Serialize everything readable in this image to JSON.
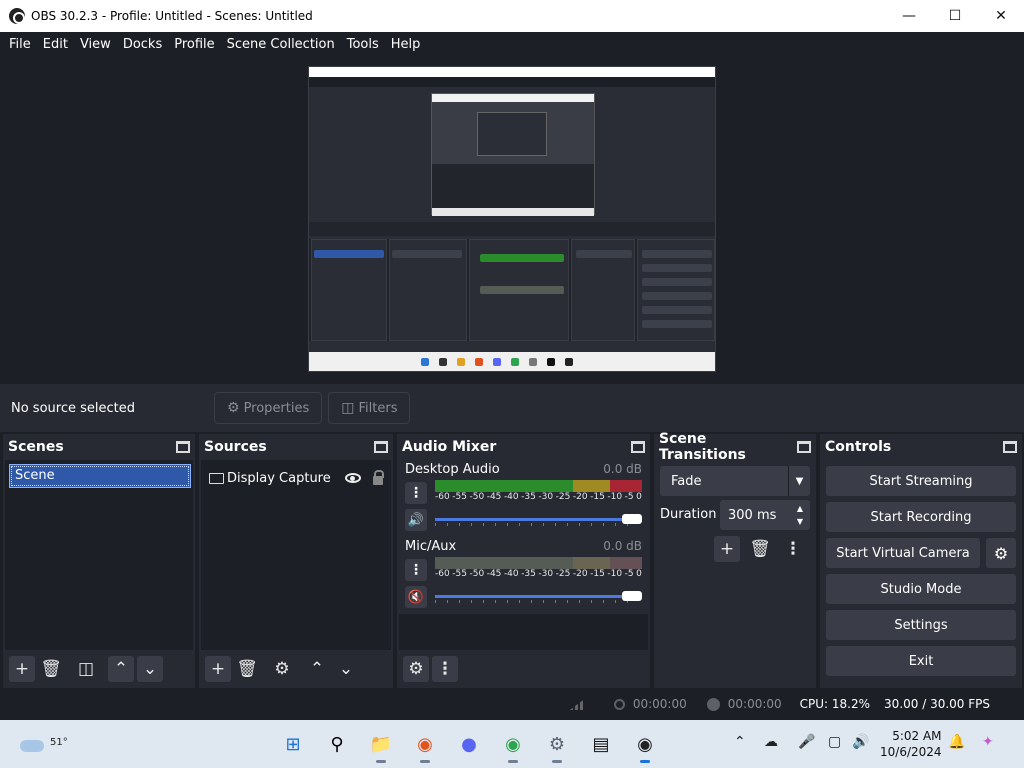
{
  "window": {
    "title": "OBS 30.2.3 - Profile: Untitled - Scenes: Untitled"
  },
  "menu": [
    "File",
    "Edit",
    "View",
    "Docks",
    "Profile",
    "Scene Collection",
    "Tools",
    "Help"
  ],
  "source_bar": {
    "no_source": "No source selected",
    "properties": "Properties",
    "filters": "Filters"
  },
  "docks": {
    "scenes": {
      "title": "Scenes",
      "items": [
        "Scene"
      ]
    },
    "sources": {
      "title": "Sources",
      "items": [
        "Display Capture"
      ]
    },
    "mixer": {
      "title": "Audio Mixer",
      "channels": [
        {
          "name": "Desktop Audio",
          "db": "0.0 dB",
          "muted": false
        },
        {
          "name": "Mic/Aux",
          "db": "0.0 dB",
          "muted": true
        }
      ],
      "ticks": [
        "-60",
        "-55",
        "-50",
        "-45",
        "-40",
        "-35",
        "-30",
        "-25",
        "-20",
        "-15",
        "-10",
        "-5",
        "0"
      ]
    },
    "transitions": {
      "title": "Scene Transitions",
      "selected": "Fade",
      "duration_label": "Duration",
      "duration": "300 ms"
    },
    "controls": {
      "title": "Controls",
      "start_streaming": "Start Streaming",
      "start_recording": "Start Recording",
      "start_virtual_camera": "Start Virtual Camera",
      "studio_mode": "Studio Mode",
      "settings": "Settings",
      "exit": "Exit"
    }
  },
  "status": {
    "stream_time": "00:00:00",
    "record_time": "00:00:00",
    "cpu": "CPU: 18.2%",
    "fps": "30.00 / 30.00 FPS"
  },
  "taskbar": {
    "temperature": "51°",
    "time": "5:02 AM",
    "date": "10/6/2024"
  },
  "colors": {
    "accent": "#2f59a8",
    "background": "#1d1f26",
    "panel": "#272a33",
    "button": "#3a3d47",
    "mute": "#c3272f"
  }
}
